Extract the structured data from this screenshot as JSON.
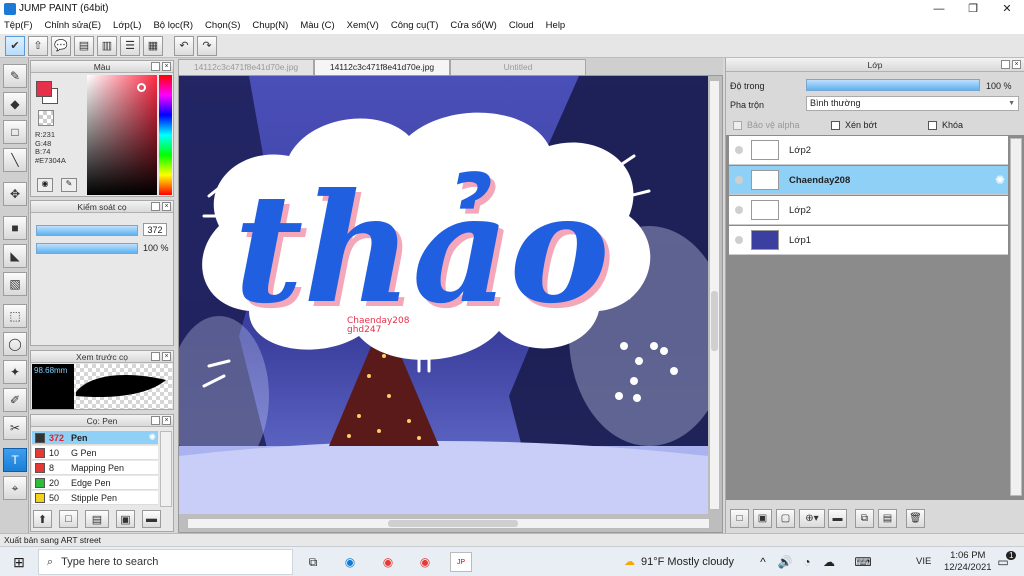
{
  "window": {
    "title": "JUMP PAINT (64bit)",
    "controls": [
      "—",
      "❐",
      "✕"
    ]
  },
  "menu": [
    "Tệp(F)",
    "Chỉnh sửa(E)",
    "Lớp(L)",
    "Bộ lọc(R)",
    "Chọn(S)",
    "Chụp(N)",
    "Màu (C)",
    "Xem(V)",
    "Công cụ(T)",
    "Cửa sổ(W)",
    "Cloud",
    "Help"
  ],
  "color_panel": {
    "title": "Màu",
    "rgb": [
      "R:231",
      "G:48",
      "B:74"
    ],
    "hex": "#E7304A",
    "primary": "#e7304a"
  },
  "brush_control": {
    "title": "Kiểm soát cọ",
    "size": "372",
    "opacity": "100 %"
  },
  "brush_preview": {
    "title": "Xem trước cọ",
    "size": "98.68mm"
  },
  "pen_list": {
    "title": "Cọ: Pen",
    "items": [
      {
        "num": "372",
        "name": "Pen",
        "color": "#333333"
      },
      {
        "num": "10",
        "name": "G Pen",
        "color": "#e53935"
      },
      {
        "num": "8",
        "name": "Mapping Pen",
        "color": "#e53935"
      },
      {
        "num": "20",
        "name": "Edge Pen",
        "color": "#2ebd3a"
      },
      {
        "num": "50",
        "name": "Stipple Pen",
        "color": "#f2d21b"
      }
    ]
  },
  "tabs": [
    "14112c3c471f8e41d70e.jpg",
    "14112c3c471f8e41d70e.jpg",
    "Untitled"
  ],
  "artwork": {
    "word": "thảo",
    "signature": [
      "Chaenday208",
      "ghd247"
    ]
  },
  "layer_panel": {
    "title": "Lớp",
    "opacity_label": "Độ trong",
    "opacity_value": "100 %",
    "blend_label": "Pha trộn",
    "blend_value": "Bình thường",
    "checks": [
      "Bảo vệ alpha",
      "Xén bớt",
      "Khóa"
    ],
    "layers": [
      "Lớp2",
      "Chaenday208",
      "Lớp2",
      "Lớp1"
    ]
  },
  "status": "Xuất bản sang ART street",
  "taskbar": {
    "search": "Type here to search",
    "weather": "91°F  Mostly cloudy",
    "lang": "VIE",
    "time": "1:06 PM",
    "date": "12/24/2021",
    "notif": "1"
  }
}
